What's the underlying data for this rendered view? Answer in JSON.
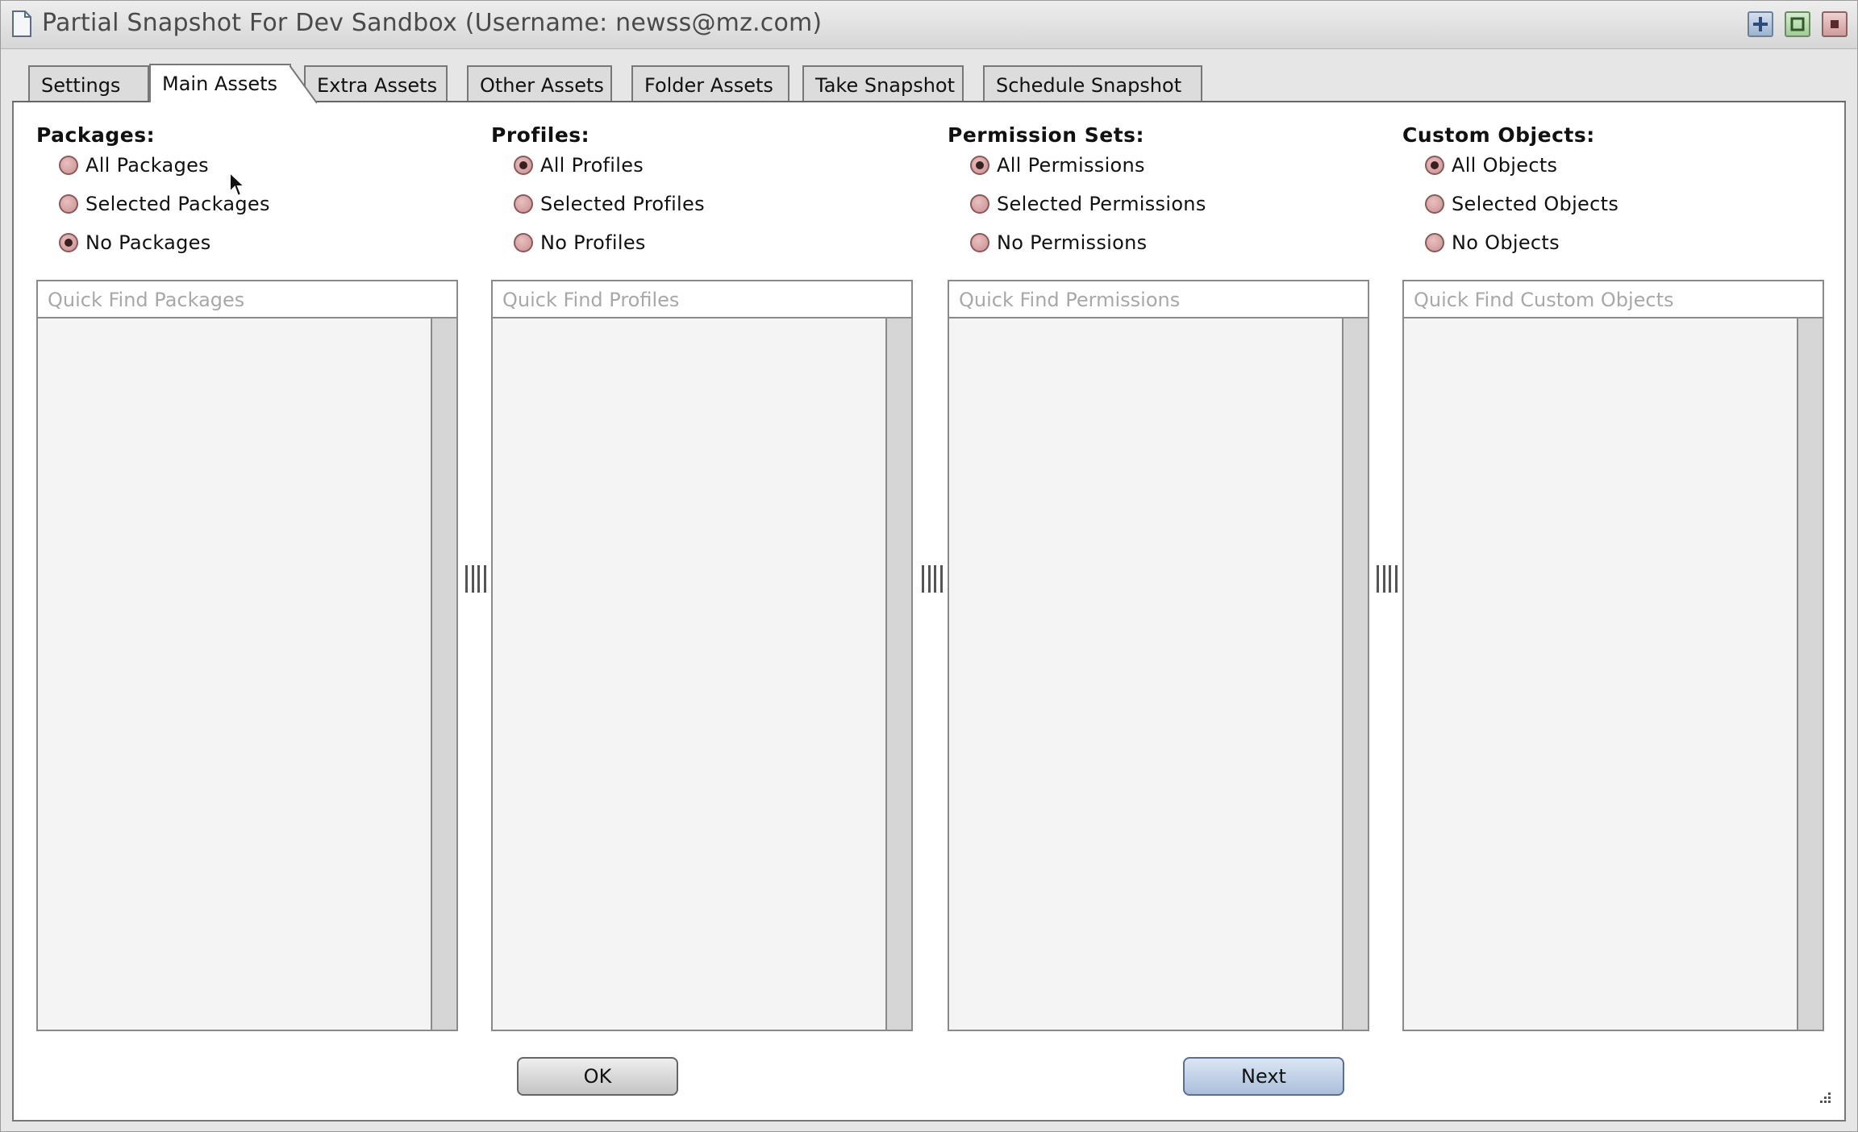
{
  "window": {
    "title": "Partial Snapshot For Dev Sandbox (Username: newss@mz.com)"
  },
  "tabs": [
    {
      "label": "Settings",
      "active": false
    },
    {
      "label": "Main Assets",
      "active": true
    },
    {
      "label": "Extra Assets",
      "active": false
    },
    {
      "label": "Other Assets",
      "active": false
    },
    {
      "label": "Folder Assets",
      "active": false
    },
    {
      "label": "Take Snapshot",
      "active": false
    },
    {
      "label": "Schedule Snapshot",
      "active": false
    }
  ],
  "panels": [
    {
      "title": "Packages:",
      "options": [
        {
          "label": "All Packages",
          "checked": false
        },
        {
          "label": "Selected Packages",
          "checked": false
        },
        {
          "label": "No Packages",
          "checked": true
        }
      ],
      "search_placeholder": "Quick Find Packages"
    },
    {
      "title": "Profiles:",
      "options": [
        {
          "label": "All Profiles",
          "checked": true
        },
        {
          "label": "Selected Profiles",
          "checked": false
        },
        {
          "label": "No Profiles",
          "checked": false
        }
      ],
      "search_placeholder": "Quick Find Profiles"
    },
    {
      "title": "Permission Sets:",
      "options": [
        {
          "label": "All Permissions",
          "checked": true
        },
        {
          "label": "Selected Permissions",
          "checked": false
        },
        {
          "label": "No Permissions",
          "checked": false
        }
      ],
      "search_placeholder": "Quick Find Permissions"
    },
    {
      "title": "Custom Objects:",
      "options": [
        {
          "label": "All Objects",
          "checked": true
        },
        {
          "label": "Selected Objects",
          "checked": false
        },
        {
          "label": "No Objects",
          "checked": false
        }
      ],
      "search_placeholder": "Quick Find Custom Objects"
    }
  ],
  "buttons": {
    "ok_label": "OK",
    "next_label": "Next"
  },
  "colors": {
    "radio_fill": "#c98f8f",
    "next_button": "#a9bfdc",
    "close_button": "#cf9c9c",
    "maximize_button": "#a4cb98"
  }
}
